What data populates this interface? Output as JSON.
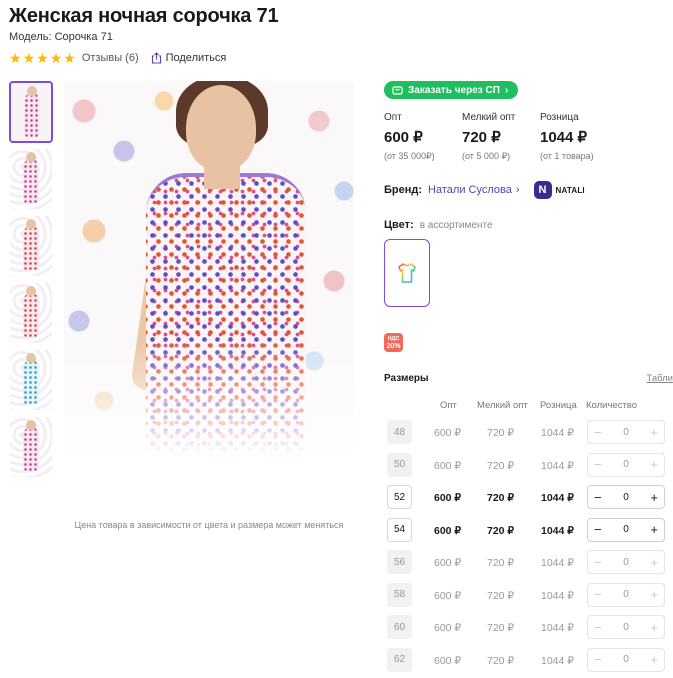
{
  "product": {
    "title": "Женская ночная сорочка 71",
    "model": "Модель: Сорочка 71",
    "rating_stars": 5,
    "reviews": "Отзывы (6)",
    "share": "Поделиться"
  },
  "photo_caption": "Цена товара в зависимости от цвета и размера может меняться",
  "sp_button": "Заказать через СП",
  "prices": [
    {
      "label": "Опт",
      "value": "600 ₽",
      "note": "(от 35 000₽)"
    },
    {
      "label": "Мелкий опт",
      "value": "720 ₽",
      "note": "(от 5 000 ₽)"
    },
    {
      "label": "Розница",
      "value": "1044 ₽",
      "note": "(от 1 товара)"
    }
  ],
  "brand": {
    "label": "Бренд:",
    "name": "Натали Суслова",
    "logo_letter": "N",
    "logo_text": "NATALI"
  },
  "color": {
    "label": "Цвет:",
    "note": "в ассортименте"
  },
  "nds_badge": {
    "top": "НДС",
    "bottom": "20%"
  },
  "sizes": {
    "title": "Размеры",
    "table_link": "Табли",
    "columns": {
      "opt": "Опт",
      "mopt": "Мелкий опт",
      "retail": "Розница",
      "qty": "Количество"
    },
    "rows": [
      {
        "size": "48",
        "opt": "600 ₽",
        "mopt": "720 ₽",
        "retail": "1044 ₽",
        "qty": "0",
        "available": false
      },
      {
        "size": "50",
        "opt": "600 ₽",
        "mopt": "720 ₽",
        "retail": "1044 ₽",
        "qty": "0",
        "available": false
      },
      {
        "size": "52",
        "opt": "600 ₽",
        "mopt": "720 ₽",
        "retail": "1044 ₽",
        "qty": "0",
        "available": true
      },
      {
        "size": "54",
        "opt": "600 ₽",
        "mopt": "720 ₽",
        "retail": "1044 ₽",
        "qty": "0",
        "available": true
      },
      {
        "size": "56",
        "opt": "600 ₽",
        "mopt": "720 ₽",
        "retail": "1044 ₽",
        "qty": "0",
        "available": false
      },
      {
        "size": "58",
        "opt": "600 ₽",
        "mopt": "720 ₽",
        "retail": "1044 ₽",
        "qty": "0",
        "available": false
      },
      {
        "size": "60",
        "opt": "600 ₽",
        "mopt": "720 ₽",
        "retail": "1044 ₽",
        "qty": "0",
        "available": false
      },
      {
        "size": "62",
        "opt": "600 ₽",
        "mopt": "720 ₽",
        "retail": "1044 ₽",
        "qty": "0",
        "available": false
      }
    ]
  },
  "colors": {
    "accent": "#7b4bd9",
    "sp_green": "#1fbf5f",
    "star": "#ffb800",
    "brand_link": "#5a3fb8",
    "nds": "#f26a5a"
  }
}
